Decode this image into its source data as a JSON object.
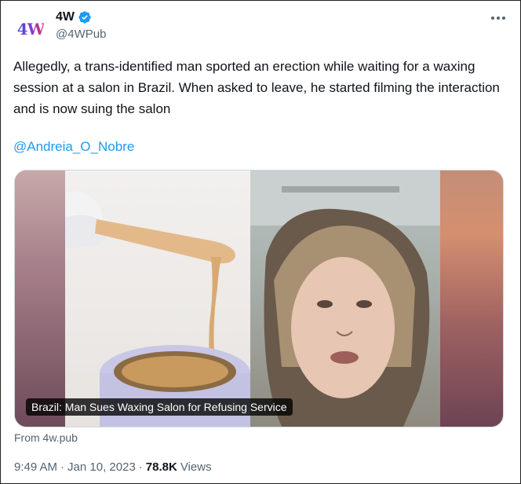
{
  "account": {
    "logo_text": "4W",
    "display_name": "4W",
    "handle": "@4WPub",
    "verified": true
  },
  "tweet": {
    "text": "Allegedly, a trans-identified man sported an erection while waiting for a waxing session at a salon in Brazil. When asked to leave, he started filming the interaction and is now suing the salon",
    "mention": "@Andreia_O_Nobre"
  },
  "media": {
    "caption": "Brazil: Man Sues Waxing Salon for Refusing Service"
  },
  "card": {
    "source": "From 4w.pub"
  },
  "meta": {
    "time": "9:49 AM",
    "separator": "·",
    "date": "Jan 10, 2023",
    "views_count": "78.8K",
    "views_label": "Views"
  },
  "colors": {
    "link": "#1d9bf0",
    "verified_badge": "#1d9bf0",
    "muted_text": "#536471"
  },
  "icons": {
    "verified": "verified-badge-icon",
    "more": "more-horizontal-icon"
  }
}
